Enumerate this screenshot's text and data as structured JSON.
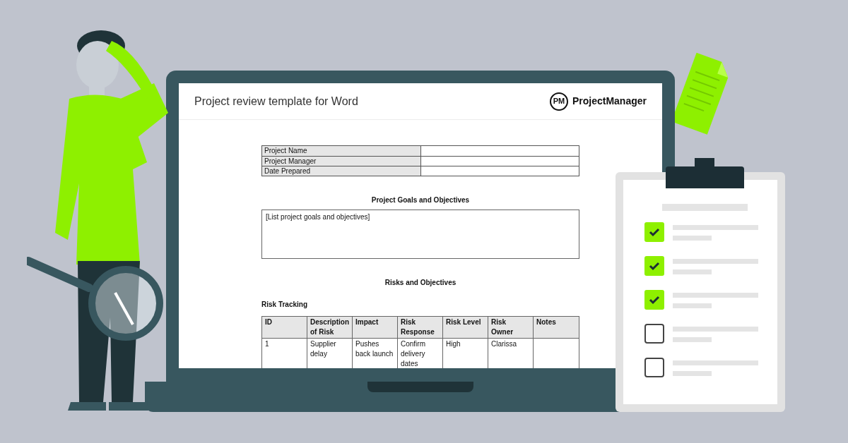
{
  "document": {
    "title": "Project review template for Word",
    "brand": {
      "monogram": "PM",
      "name": "ProjectManager"
    },
    "info_table": [
      {
        "label": "Project Name"
      },
      {
        "label": "Project Manager"
      },
      {
        "label": "Date Prepared"
      }
    ],
    "goals": {
      "heading": "Project Goals and Objectives",
      "text": "[List project goals and objectives]"
    },
    "risks": {
      "heading": "Risks and Objectives",
      "subheading": "Risk Tracking",
      "columns": [
        "ID",
        "Description of Risk",
        "Impact",
        "Risk Response",
        "Risk Level",
        "Risk Owner",
        "Notes"
      ],
      "rows": [
        [
          "1",
          "Supplier delay",
          "Pushes back launch",
          "Confirm delivery dates",
          "High",
          "Clarissa",
          null
        ]
      ]
    }
  },
  "checklist": [
    {
      "checked": true
    },
    {
      "checked": true
    },
    {
      "checked": true
    },
    {
      "checked": false
    },
    {
      "checked": false
    }
  ]
}
